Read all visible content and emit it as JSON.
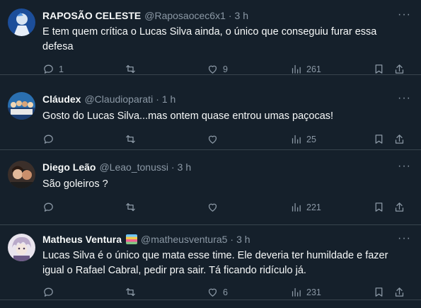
{
  "tweets": [
    {
      "name": "RAPOSÃO CELESTE",
      "handle": "@Raposaocec6x1",
      "sep": "·",
      "time": "3 h",
      "text": "E tem quem crítica o Lucas Silva ainda, o único que conseguiu furar essa defesa",
      "replies": "1",
      "retweets": "",
      "likes": "9",
      "views": "261",
      "more": "···"
    },
    {
      "name": "Cláudex",
      "handle": "@Claudioparati",
      "sep": "·",
      "time": "1 h",
      "text": "Gosto do Lucas Silva...mas ontem quase entrou umas paçocas!",
      "replies": "",
      "retweets": "",
      "likes": "",
      "views": "25",
      "more": "···"
    },
    {
      "name": "Diego Leão",
      "handle": "@Leao_tonussi",
      "sep": "·",
      "time": "3 h",
      "text": "São goleiros ?",
      "replies": "",
      "retweets": "",
      "likes": "",
      "views": "221",
      "more": "···"
    },
    {
      "name": "Matheus Ventura",
      "handle": "@matheusventura5",
      "sep": "·",
      "time": "3 h",
      "text": "Lucas Silva é o único que mata esse time. Ele deveria ter humildade e fazer igual o Rafael Cabral, pedir pra sair. Tá ficando ridículo já.",
      "replies": "",
      "retweets": "",
      "likes": "6",
      "views": "231",
      "more": "···"
    }
  ],
  "icons": {
    "reply": "reply-icon",
    "retweet": "retweet-icon",
    "like": "heart-icon",
    "views": "views-icon",
    "bookmark": "bookmark-icon",
    "share": "share-icon"
  },
  "colors": {
    "background": "#15202b",
    "text": "#f7f9f9",
    "muted": "#8b98a5",
    "divider": "#38444d"
  }
}
